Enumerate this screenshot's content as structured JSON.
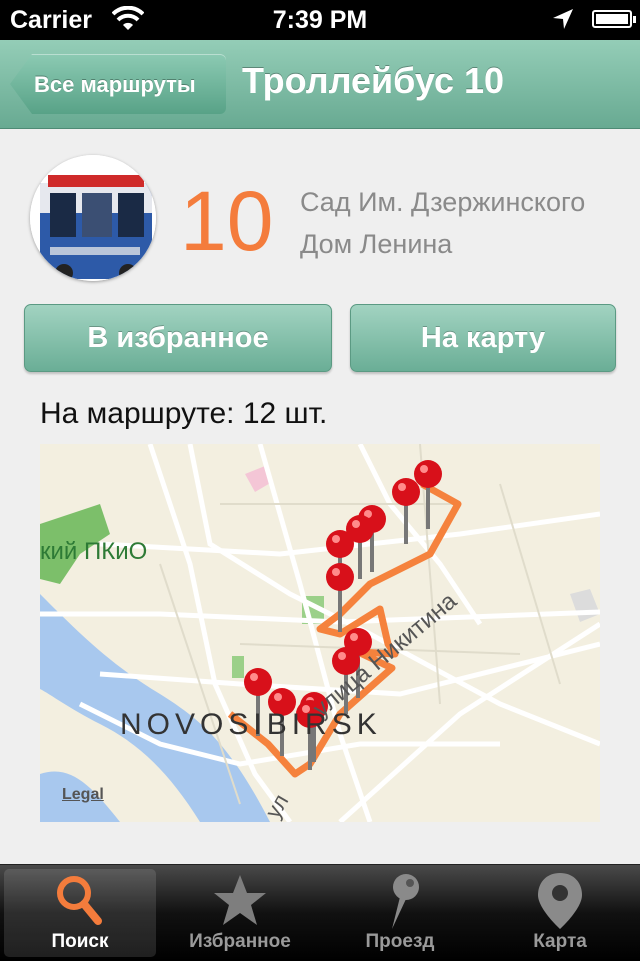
{
  "status_bar": {
    "carrier": "Carrier",
    "time": "7:39 PM"
  },
  "nav": {
    "back_label": "Все маршруты",
    "title": "Троллейбус 10"
  },
  "route": {
    "number": "10",
    "from": "Сад Им. Дзержинского",
    "to": "Дом Ленина"
  },
  "actions": {
    "favorite_label": "В избранное",
    "map_label": "На карту"
  },
  "on_route": "На маршруте: 12 шт.",
  "map": {
    "park_label": "кий ПКиО",
    "city_label": "NOVOSIBIRSK",
    "street_label": "улица Никитина",
    "street_label_2": "ул",
    "legal_label": "Legal",
    "route_color": "#f5823d",
    "pin_color": "#d8101a"
  },
  "tabs": [
    {
      "label": "Поиск",
      "icon": "search-icon",
      "active": true
    },
    {
      "label": "Избранное",
      "icon": "star-icon",
      "active": false
    },
    {
      "label": "Проезд",
      "icon": "pin-icon",
      "active": false
    },
    {
      "label": "Карта",
      "icon": "map-marker-icon",
      "active": false
    }
  ]
}
